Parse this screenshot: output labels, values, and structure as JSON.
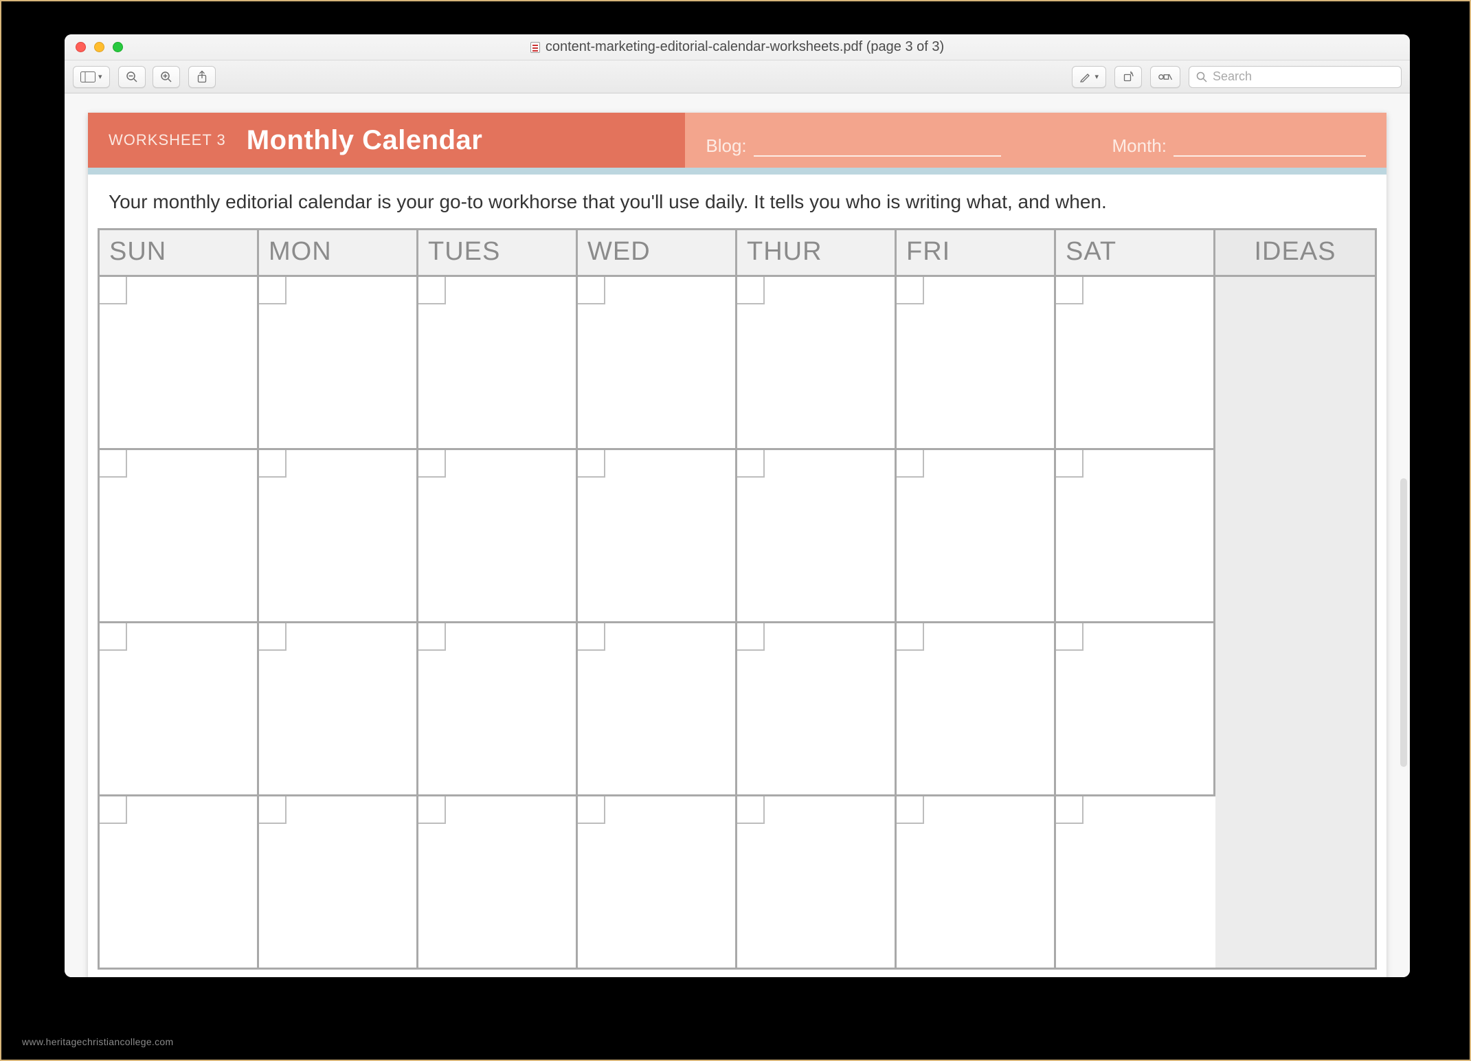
{
  "window": {
    "title": "content-marketing-editorial-calendar-worksheets.pdf (page 3 of 3)"
  },
  "search": {
    "placeholder": "Search"
  },
  "worksheet": {
    "tag": "WORKSHEET 3",
    "title": "Monthly Calendar",
    "blog_label": "Blog:",
    "month_label": "Month:",
    "intro": "Your monthly editorial calendar is your go-to workhorse that you'll use daily. It tells you who is writing what, and when.",
    "columns": [
      "SUN",
      "MON",
      "TUES",
      "WED",
      "THUR",
      "FRI",
      "SAT",
      "IDEAS"
    ]
  },
  "watermark": "www.heritagechristiancollege.com"
}
